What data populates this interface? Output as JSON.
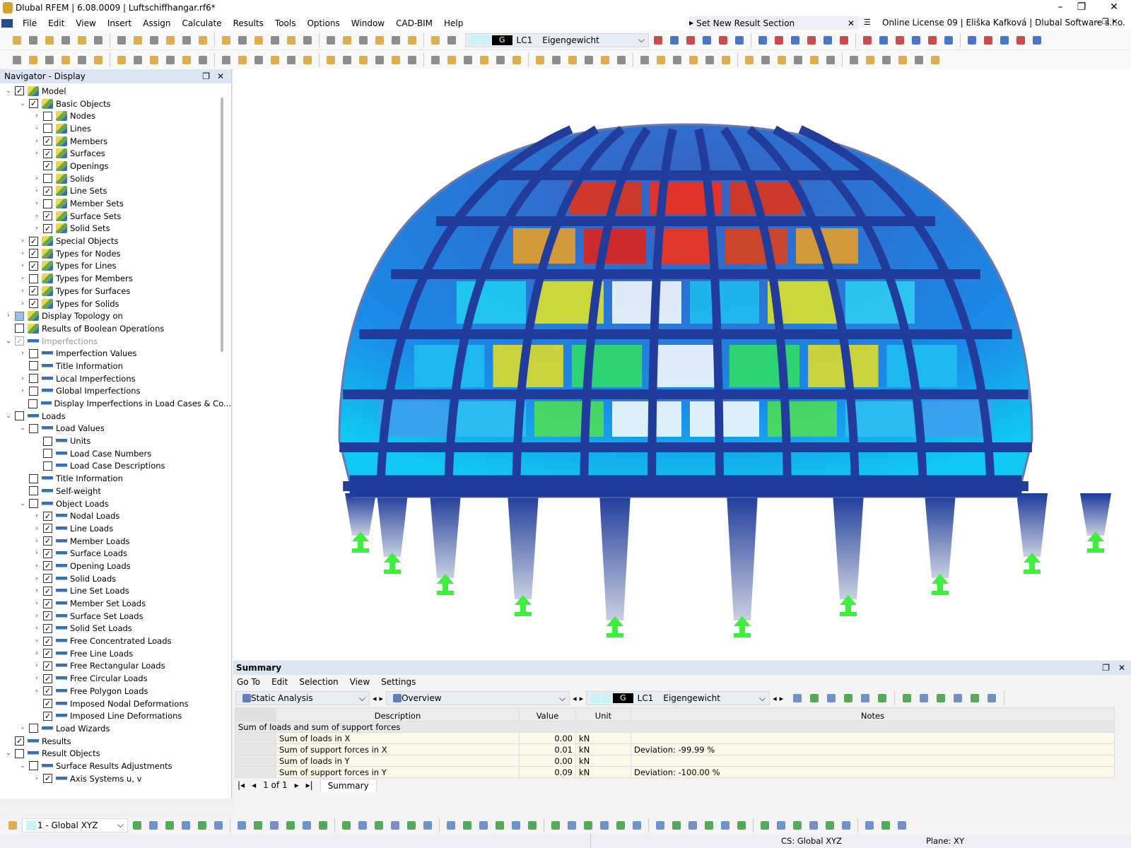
{
  "window": {
    "title": "Dlubal RFEM | 6.08.0009 | Luftschiffhangar.rf6*",
    "license": "Online License 09 | Eliška Kafková | Dlubal Software s.r.o.",
    "result_section": "Set New Result Section"
  },
  "menu": [
    "File",
    "Edit",
    "View",
    "Insert",
    "Assign",
    "Calculate",
    "Results",
    "Tools",
    "Options",
    "Window",
    "CAD-BIM",
    "Help"
  ],
  "toolbar": {
    "lc_badge": "G",
    "lc_id": "LC1",
    "lc_name": "Eigengewicht"
  },
  "navigator": {
    "title": "Navigator - Display",
    "items": [
      {
        "l": 0,
        "e": "v",
        "c": "on",
        "t": "Model"
      },
      {
        "l": 1,
        "e": "v",
        "c": "on",
        "t": "Basic Objects"
      },
      {
        "l": 2,
        "e": ">",
        "c": "off",
        "t": "Nodes"
      },
      {
        "l": 2,
        "e": ">",
        "c": "off",
        "t": "Lines"
      },
      {
        "l": 2,
        "e": ">",
        "c": "on",
        "t": "Members"
      },
      {
        "l": 2,
        "e": ">",
        "c": "on",
        "t": "Surfaces"
      },
      {
        "l": 2,
        "e": "",
        "c": "on",
        "t": "Openings"
      },
      {
        "l": 2,
        "e": ">",
        "c": "off",
        "t": "Solids"
      },
      {
        "l": 2,
        "e": ">",
        "c": "on",
        "t": "Line Sets"
      },
      {
        "l": 2,
        "e": ">",
        "c": "off",
        "t": "Member Sets"
      },
      {
        "l": 2,
        "e": ">",
        "c": "on",
        "t": "Surface Sets"
      },
      {
        "l": 2,
        "e": ">",
        "c": "on",
        "t": "Solid Sets"
      },
      {
        "l": 1,
        "e": ">",
        "c": "on",
        "t": "Special Objects"
      },
      {
        "l": 1,
        "e": ">",
        "c": "on",
        "t": "Types for Nodes"
      },
      {
        "l": 1,
        "e": ">",
        "c": "on",
        "t": "Types for Lines"
      },
      {
        "l": 1,
        "e": ">",
        "c": "off",
        "t": "Types for Members"
      },
      {
        "l": 1,
        "e": ">",
        "c": "on",
        "t": "Types for Surfaces"
      },
      {
        "l": 1,
        "e": ">",
        "c": "on",
        "t": "Types for Solids"
      },
      {
        "l": 0,
        "e": ">",
        "c": "partial",
        "t": "Display Topology on"
      },
      {
        "l": 0,
        "e": "",
        "c": "off",
        "t": "Results of Boolean Operations"
      },
      {
        "l": 0,
        "e": "v",
        "c": "grey",
        "t": "Imperfections",
        "i": "imp"
      },
      {
        "l": 1,
        "e": ">",
        "c": "off",
        "t": "Imperfection Values",
        "i": "imp"
      },
      {
        "l": 1,
        "e": "",
        "c": "off",
        "t": "Title Information",
        "i": "imp"
      },
      {
        "l": 1,
        "e": ">",
        "c": "off",
        "t": "Local Imperfections",
        "i": "imp"
      },
      {
        "l": 1,
        "e": ">",
        "c": "off",
        "t": "Global Imperfections",
        "i": "imp"
      },
      {
        "l": 1,
        "e": "",
        "c": "off",
        "t": "Display Imperfections in Load Cases & Co...",
        "i": "imp"
      },
      {
        "l": 0,
        "e": "v",
        "c": "off",
        "t": "Loads",
        "i": "ld"
      },
      {
        "l": 1,
        "e": "v",
        "c": "off",
        "t": "Load Values",
        "i": "ld"
      },
      {
        "l": 2,
        "e": "",
        "c": "off",
        "t": "Units",
        "i": "ld"
      },
      {
        "l": 2,
        "e": "",
        "c": "off",
        "t": "Load Case Numbers",
        "i": "ld"
      },
      {
        "l": 2,
        "e": "",
        "c": "off",
        "t": "Load Case Descriptions",
        "i": "ld"
      },
      {
        "l": 1,
        "e": "",
        "c": "off",
        "t": "Title Information",
        "i": "ld"
      },
      {
        "l": 1,
        "e": "",
        "c": "off",
        "t": "Self-weight",
        "i": "ld"
      },
      {
        "l": 1,
        "e": "v",
        "c": "off",
        "t": "Object Loads",
        "i": "ld"
      },
      {
        "l": 2,
        "e": ">",
        "c": "on",
        "t": "Nodal Loads",
        "i": "ld"
      },
      {
        "l": 2,
        "e": ">",
        "c": "on",
        "t": "Line Loads",
        "i": "ld"
      },
      {
        "l": 2,
        "e": ">",
        "c": "on",
        "t": "Member Loads",
        "i": "ld"
      },
      {
        "l": 2,
        "e": ">",
        "c": "on",
        "t": "Surface Loads",
        "i": "ld"
      },
      {
        "l": 2,
        "e": ">",
        "c": "on",
        "t": "Opening Loads",
        "i": "ld"
      },
      {
        "l": 2,
        "e": ">",
        "c": "on",
        "t": "Solid Loads",
        "i": "ld"
      },
      {
        "l": 2,
        "e": ">",
        "c": "on",
        "t": "Line Set Loads",
        "i": "ld"
      },
      {
        "l": 2,
        "e": ">",
        "c": "on",
        "t": "Member Set Loads",
        "i": "ld"
      },
      {
        "l": 2,
        "e": ">",
        "c": "on",
        "t": "Surface Set Loads",
        "i": "ld"
      },
      {
        "l": 2,
        "e": ">",
        "c": "on",
        "t": "Solid Set Loads",
        "i": "ld"
      },
      {
        "l": 2,
        "e": ">",
        "c": "on",
        "t": "Free Concentrated Loads",
        "i": "ld"
      },
      {
        "l": 2,
        "e": ">",
        "c": "on",
        "t": "Free Line Loads",
        "i": "ld"
      },
      {
        "l": 2,
        "e": ">",
        "c": "on",
        "t": "Free Rectangular Loads",
        "i": "ld"
      },
      {
        "l": 2,
        "e": ">",
        "c": "on",
        "t": "Free Circular Loads",
        "i": "ld"
      },
      {
        "l": 2,
        "e": ">",
        "c": "on",
        "t": "Free Polygon Loads",
        "i": "ld"
      },
      {
        "l": 2,
        "e": "",
        "c": "on",
        "t": "Imposed Nodal Deformations",
        "i": "ld"
      },
      {
        "l": 2,
        "e": "",
        "c": "on",
        "t": "Imposed Line Deformations",
        "i": "ld"
      },
      {
        "l": 1,
        "e": ">",
        "c": "off",
        "t": "Load Wizards",
        "i": "ld"
      },
      {
        "l": 0,
        "e": "",
        "c": "on",
        "t": "Results",
        "i": "ld"
      },
      {
        "l": 0,
        "e": "v",
        "c": "off",
        "t": "Result Objects",
        "i": "ld"
      },
      {
        "l": 1,
        "e": "v",
        "c": "off",
        "t": "Surface Results Adjustments",
        "i": "ld"
      },
      {
        "l": 2,
        "e": ">",
        "c": "on",
        "t": "Axis Systems u, v",
        "i": "ld"
      }
    ]
  },
  "summary": {
    "title": "Summary",
    "menu": [
      "Go To",
      "Edit",
      "Selection",
      "View",
      "Settings"
    ],
    "analysis": "Static Analysis",
    "overview": "Overview",
    "lc_badge": "G",
    "lc_id": "LC1",
    "lc_name": "Eigengewicht",
    "columns": [
      "Description",
      "Value",
      "Unit",
      "Notes"
    ],
    "group": "Sum of loads and sum of support forces",
    "rows": [
      [
        "Sum of loads in X",
        "0.00",
        "kN",
        ""
      ],
      [
        "Sum of support forces in X",
        "0.01",
        "kN",
        "Deviation: -99.99 %"
      ],
      [
        "Sum of loads in Y",
        "0.00",
        "kN",
        ""
      ],
      [
        "Sum of support forces in Y",
        "0.09",
        "kN",
        "Deviation: -100.00 %"
      ]
    ],
    "pager": "1 of 1",
    "tab": "Summary"
  },
  "bottom": {
    "cs_combo": "1 - Global XYZ"
  },
  "status": {
    "cs": "CS: Global XYZ",
    "plane": "Plane: XY"
  },
  "colors": {
    "accent": "#dbe6f2",
    "structure": "#1f3d9a",
    "support": "#3cf03c",
    "max": "#e82010"
  }
}
